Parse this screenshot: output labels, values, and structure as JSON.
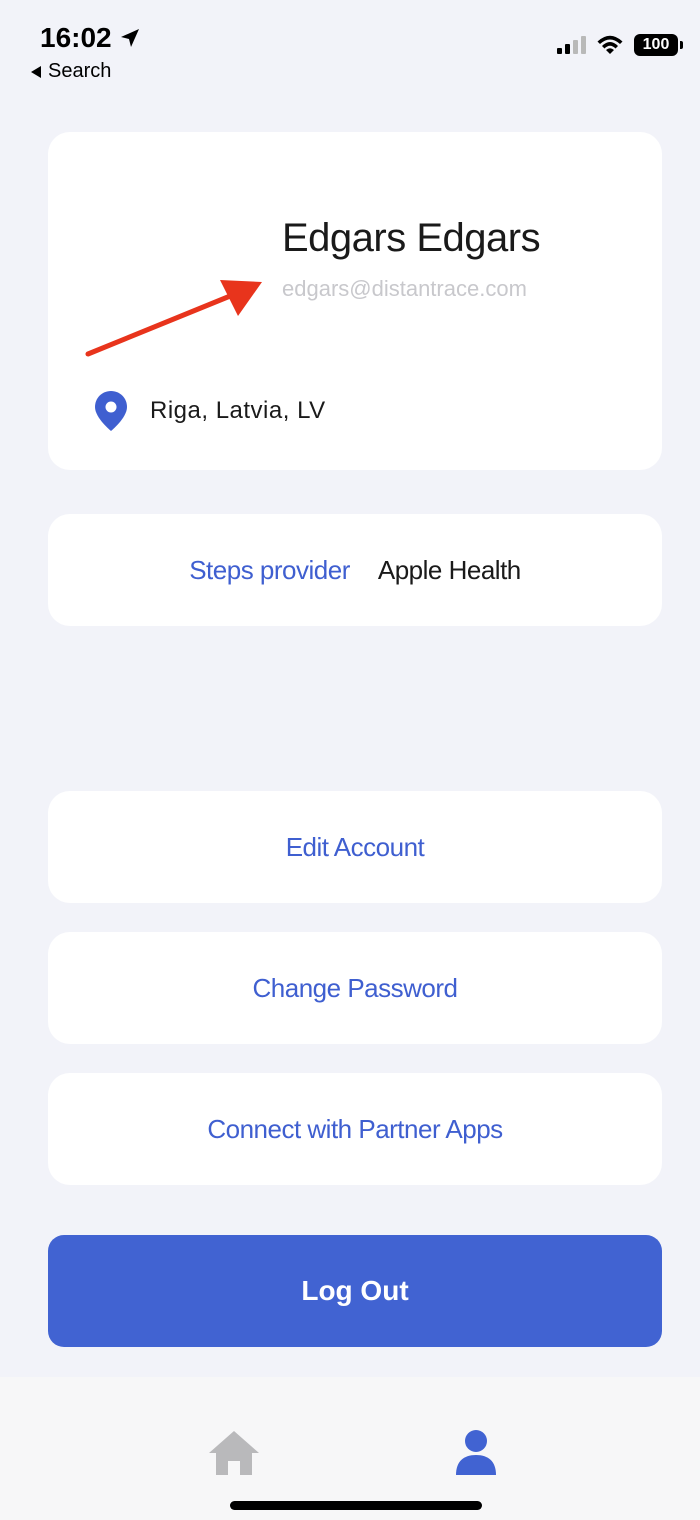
{
  "status_bar": {
    "time": "16:02",
    "back_label": "Search",
    "battery": "100"
  },
  "profile": {
    "name": "Edgars Edgars",
    "email": "edgars@distantrace.com",
    "location": "Riga, Latvia, LV"
  },
  "steps": {
    "label": "Steps provider",
    "value": "Apple Health"
  },
  "actions": {
    "edit_account": "Edit Account",
    "change_password": "Change Password",
    "connect_partner_apps": "Connect with Partner Apps",
    "log_out": "Log Out"
  },
  "tab_bar": {
    "tabs": [
      {
        "icon": "home-icon",
        "active": false
      },
      {
        "icon": "profile-icon",
        "active": true
      }
    ]
  },
  "colors": {
    "accent": "#4163d2",
    "link": "#3f5fd0",
    "annotation_arrow": "#e8341c",
    "background": "#f2f3f9"
  }
}
